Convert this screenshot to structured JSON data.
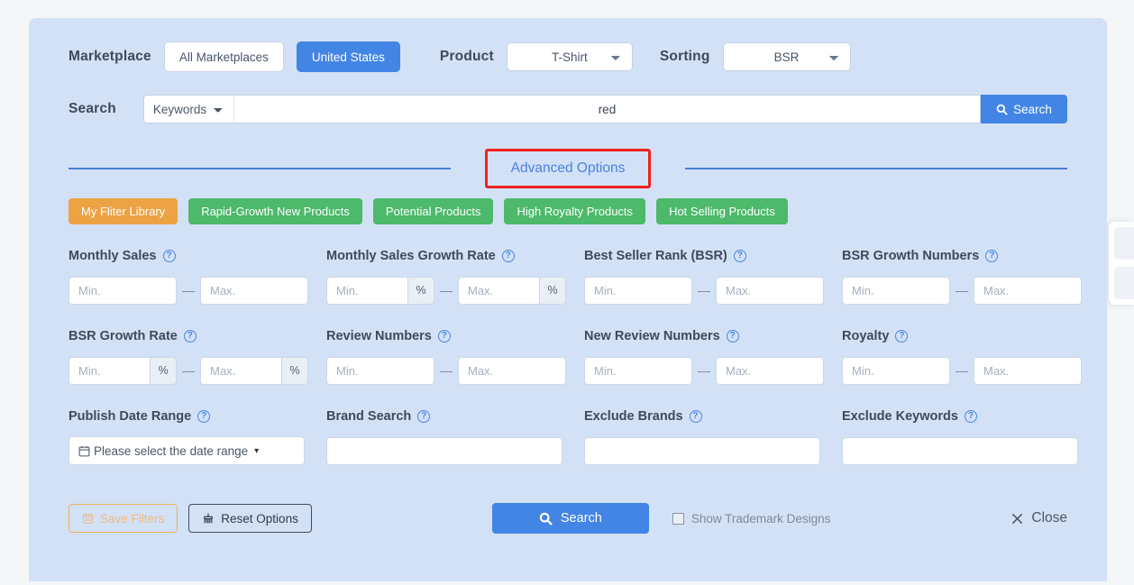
{
  "marketplace": {
    "label": "Marketplace",
    "options": [
      {
        "label": "All Marketplaces",
        "active": false
      },
      {
        "label": "United States",
        "active": true
      }
    ]
  },
  "product": {
    "label": "Product",
    "selected": "T-Shirt"
  },
  "sorting": {
    "label": "Sorting",
    "selected": "BSR"
  },
  "search": {
    "label": "Search",
    "mode": "Keywords",
    "value": "red",
    "placeholder": "",
    "button_label": "Search",
    "icon": "search-icon"
  },
  "advanced": {
    "label": "Advanced Options",
    "highlight_color": "#ee2222",
    "link_color": "#4b82e0",
    "line_color": "#4a7fd4"
  },
  "presets": [
    {
      "label": "My Fliter Library",
      "color": "#eda244",
      "style": "orange"
    },
    {
      "label": "Rapid-Growth New Products",
      "color": "#4cb96b",
      "style": "green"
    },
    {
      "label": "Potential Products",
      "color": "#4cb96b",
      "style": "green"
    },
    {
      "label": "High Royalty Products",
      "color": "#4cb96b",
      "style": "green"
    },
    {
      "label": "Hot Selling Products",
      "color": "#4cb96b",
      "style": "green"
    }
  ],
  "filters": {
    "min_placeholder": "Min.",
    "max_placeholder": "Max.",
    "percent_symbol": "%",
    "dash": "—",
    "help_icon": "?",
    "fields": [
      {
        "label": "Monthly Sales",
        "type": "range",
        "min": "",
        "max": ""
      },
      {
        "label": "Monthly Sales Growth Rate",
        "type": "range-pct",
        "min": "",
        "max": ""
      },
      {
        "label": "Best Seller Rank (BSR)",
        "type": "range",
        "min": "",
        "max": ""
      },
      {
        "label": "BSR Growth Numbers",
        "type": "range",
        "min": "",
        "max": ""
      },
      {
        "label": "BSR Growth Rate",
        "type": "range-pct",
        "min": "",
        "max": ""
      },
      {
        "label": "Review Numbers",
        "type": "range",
        "min": "",
        "max": ""
      },
      {
        "label": "New Review Numbers",
        "type": "range",
        "min": "",
        "max": ""
      },
      {
        "label": "Royalty",
        "type": "range",
        "min": "",
        "max": ""
      },
      {
        "label": "Publish Date Range",
        "type": "daterange",
        "value": "Please select the date range"
      },
      {
        "label": "Brand Search",
        "type": "text",
        "value": "",
        "placeholder": ""
      },
      {
        "label": "Exclude Brands",
        "type": "text",
        "value": "",
        "placeholder": ""
      },
      {
        "label": "Exclude Keywords",
        "type": "text",
        "value": "",
        "placeholder": ""
      }
    ]
  },
  "footer": {
    "save_label": "Save Filters",
    "reset_label": "Reset Options",
    "search_label": "Search",
    "trademark_label": "Show Trademark Designs",
    "trademark_checked": false,
    "close_label": "Close"
  }
}
